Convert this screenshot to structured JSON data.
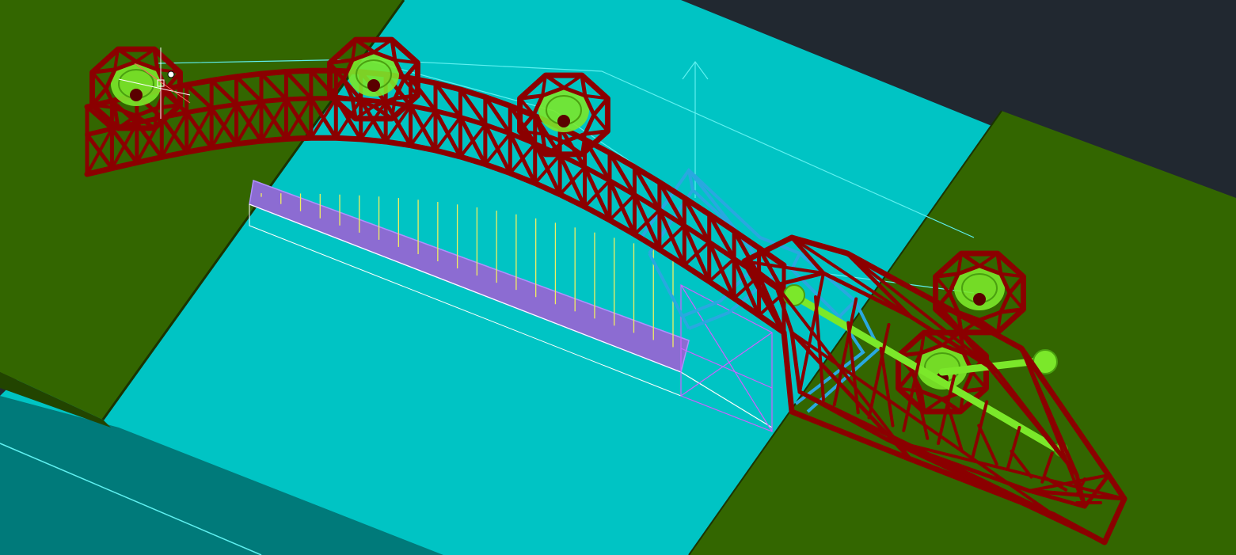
{
  "app": {
    "view": "3d-wireframe-viewport"
  },
  "colors": {
    "background": "#212830",
    "water": "#00c4c4",
    "water_edge": "#007a7a",
    "ground": "#336600",
    "ground_side": "#224400",
    "truss": "#8b0000",
    "truss_highlight": "#a40c0c",
    "selected_member": "#29a8e0",
    "roadway": "#8c6cd2",
    "hanger": "#f0f060",
    "pulley": "#7be82a",
    "guide_line": "#5ff0f0",
    "magenta_line": "#d060ff",
    "white_line": "#ffffff"
  },
  "icons": [
    "ucs-axis-icon",
    "cursor-crosshair-icon",
    "pulley-wheel-icon",
    "sphere-joint-icon"
  ]
}
